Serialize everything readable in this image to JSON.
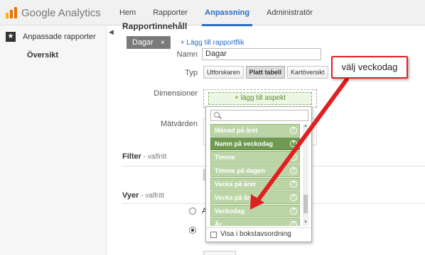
{
  "header": {
    "brand": "Google Analytics",
    "nav": [
      {
        "label": "Hem"
      },
      {
        "label": "Rapporter"
      },
      {
        "label": "Anpassning",
        "active": true
      },
      {
        "label": "Administratör"
      }
    ]
  },
  "sidebar": {
    "section_label": "Anpassade rapporter",
    "sub_item": "Översikt"
  },
  "form": {
    "section_title": "Rapportinnehåll",
    "tab_chip": "Dagar",
    "tab_chip_close": "×",
    "add_tab": "+ Lägg till rapportflik",
    "name_label": "Namn",
    "name_value": "Dagar",
    "type_label": "Typ",
    "types": [
      "Utforskaren",
      "Platt tabell",
      "Kartöversikt"
    ],
    "type_selected": "Platt tabell",
    "dimensions_label": "Dimensioner",
    "add_dimension": "+ lägg till aspekt",
    "metrics_label": "Mätvärden",
    "filter_title": "Filter",
    "filter_optional": " - valfritt",
    "views_title": "Vyer",
    "views_optional": " - valfritt",
    "radio_1_text": "Al"
  },
  "dropdown": {
    "search_placeholder": "",
    "items": [
      {
        "label": "Månad på året"
      },
      {
        "label": "Namn på veckodag",
        "highlighted": true
      },
      {
        "label": "Timme"
      },
      {
        "label": "Timme på dagen"
      },
      {
        "label": "Vecka på året"
      },
      {
        "label": "Vecka på året"
      },
      {
        "label": "Veckodag"
      },
      {
        "label": "År"
      }
    ],
    "help_glyph": "?",
    "alphabetical_label": "Visa i bokstavsordning"
  },
  "annotation": {
    "text": "välj veckodag"
  },
  "colors": {
    "accent": "#2a6cc4",
    "item_green": "#bcd5a6",
    "item_green_selected": "#6f9a4f",
    "arrow_red": "#e02020"
  }
}
